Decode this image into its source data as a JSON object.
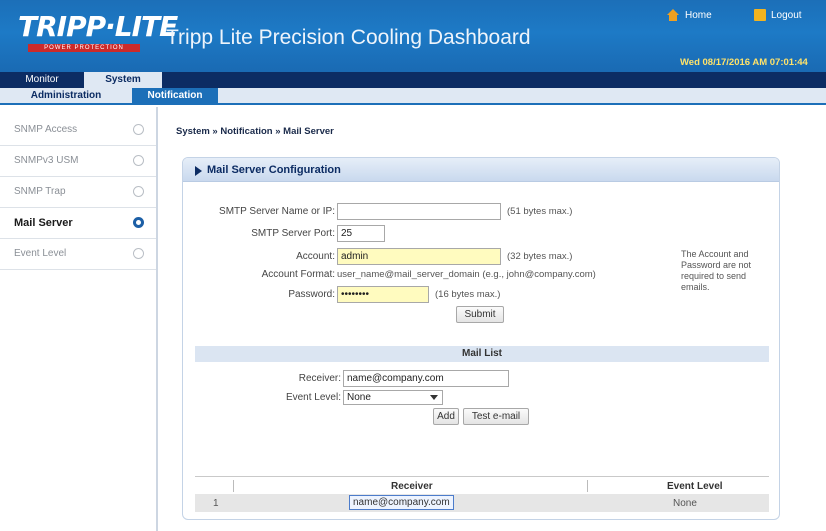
{
  "header": {
    "logo_text": "TRIPP·LITE",
    "logo_sub": "POWER PROTECTION",
    "title": "Tripp Lite Precision Cooling Dashboard",
    "home_label": "Home",
    "logout_label": "Logout",
    "datetime": "Wed 08/17/2016 AM 07:01:44"
  },
  "topnav": {
    "tabs": [
      {
        "label": "Monitor"
      },
      {
        "label": "System"
      }
    ]
  },
  "subnav": {
    "tabs": [
      {
        "label": "Administration"
      },
      {
        "label": "Notification"
      }
    ]
  },
  "sidebar": {
    "items": [
      {
        "label": "SNMP Access"
      },
      {
        "label": "SNMPv3 USM"
      },
      {
        "label": "SNMP Trap"
      },
      {
        "label": "Mail Server"
      },
      {
        "label": "Event Level"
      }
    ]
  },
  "breadcrumb": "System » Notification » Mail Server",
  "panel": {
    "title": "Mail Server Configuration",
    "smtp_name_label": "SMTP Server Name or IP:",
    "smtp_name_value": "",
    "smtp_name_hint": "(51 bytes max.)",
    "smtp_port_label": "SMTP Server Port:",
    "smtp_port_value": "25",
    "account_label": "Account:",
    "account_value": "admin",
    "account_hint": "(32 bytes max.)",
    "account_format_label": "Account Format:",
    "account_format_value": "user_name@mail_server_domain (e.g., john@company.com)",
    "password_label": "Password:",
    "password_value": "••••••••",
    "password_hint": "(16 bytes max.)",
    "submit_label": "Submit",
    "note": "The Account and Password are not required to send emails."
  },
  "maillist": {
    "title": "Mail List",
    "receiver_label": "Receiver:",
    "receiver_value": "name@company.com",
    "event_level_label": "Event Level:",
    "event_level_value": "None",
    "add_label": "Add",
    "test_label": "Test e-mail",
    "columns": [
      "Receiver",
      "Event Level"
    ],
    "rows": [
      {
        "index": "1",
        "receiver": "name@company.com",
        "event_level": "None"
      }
    ]
  }
}
